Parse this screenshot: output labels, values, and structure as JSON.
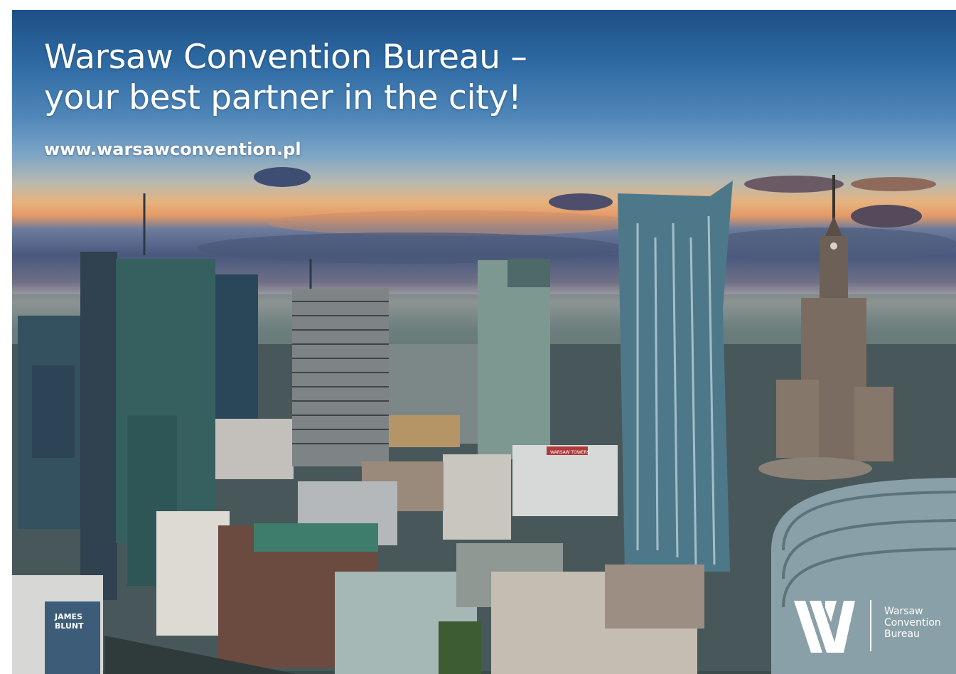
{
  "headline": {
    "line1": "Warsaw Convention Bureau –",
    "line2": "your best partner in the city!"
  },
  "url": "www.warsawconvention.pl",
  "logo": {
    "line1": "Warsaw",
    "line2": "Convention",
    "line3": "Bureau"
  },
  "image_text": {
    "tower_sign": "WARSAW TOWERS",
    "billboard_line1": "JAMES",
    "billboard_line2": "BLUNT"
  },
  "colors": {
    "text": "#ffffff",
    "sky_top": "#1e4f86",
    "sunset": "#e39a67"
  }
}
